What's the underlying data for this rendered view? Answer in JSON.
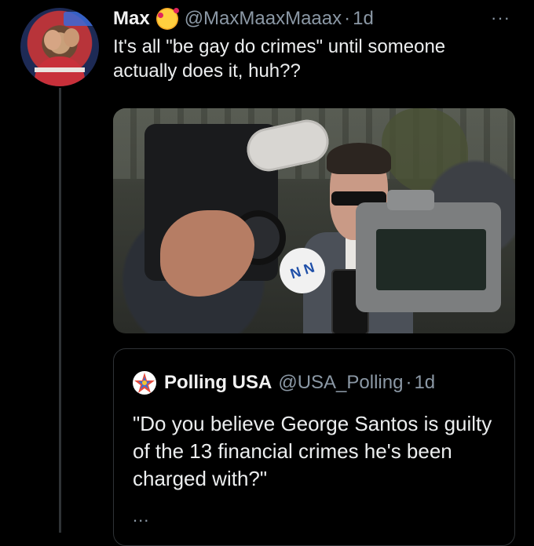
{
  "tweet": {
    "author_name": "Max",
    "author_emoji": "smiling-face-with-hearts-emoji",
    "handle": "@MaxMaaxMaaax",
    "separator": "·",
    "timestamp": "1d",
    "more_label": "···",
    "text": "It's all \"be gay do crimes\" until someone actually does it, huh??",
    "photo_badge": "N N"
  },
  "quoted_tweet": {
    "author_name": "Polling USA",
    "handle": "@USA_Polling",
    "separator": "·",
    "timestamp": "1d",
    "text": "\"Do you believe George Santos is guilty of the 13 financial crimes he's been charged with?\"",
    "truncation": "..."
  },
  "colors": {
    "background": "#000000",
    "text_primary": "#e7e9ea",
    "text_secondary": "#8b98a5",
    "border": "#2f3336"
  }
}
